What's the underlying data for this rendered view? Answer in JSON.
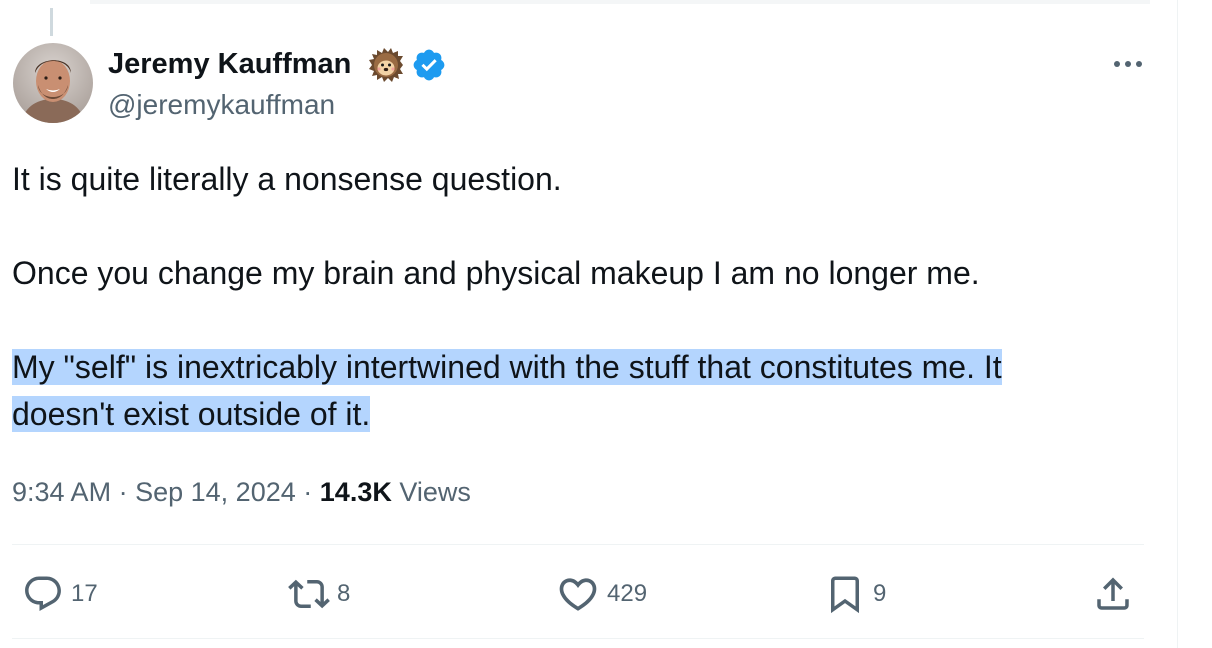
{
  "author": {
    "name": "Jeremy Kauffman",
    "handle": "@jeremykauffman",
    "badge_emoji_icon": "hedgehog-icon",
    "verified_icon": "verified-badge-icon",
    "verified_color": "#1d9bf0"
  },
  "tweet": {
    "paragraph_1": "It is quite literally a nonsense question.",
    "paragraph_2": "Once you change my brain and physical makeup I am no longer me.",
    "paragraph_3_line_1": "My \"self\" is inextricably intertwined with the stuff that constitutes me. It",
    "paragraph_3_line_2": "doesn't exist outside of it."
  },
  "meta": {
    "time": "9:34 AM",
    "date": "Sep 14, 2024",
    "separator": "·",
    "views_count": "14.3K",
    "views_label": "Views"
  },
  "actions": {
    "replies": "17",
    "reposts": "8",
    "likes": "429",
    "bookmarks": "9"
  },
  "colors": {
    "text_primary": "#0f1419",
    "text_secondary": "#536471",
    "selection_highlight": "#b4d5fe",
    "divider": "#eff3f4"
  }
}
